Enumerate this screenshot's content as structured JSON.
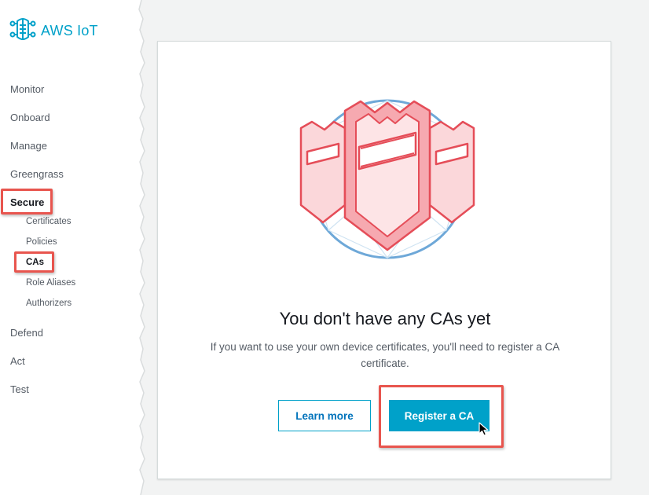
{
  "app": {
    "brand_name": "AWS IoT",
    "brand_color": "#00a1c9"
  },
  "sidebar": {
    "items": [
      {
        "label": "Monitor"
      },
      {
        "label": "Onboard"
      },
      {
        "label": "Manage"
      },
      {
        "label": "Greengrass"
      },
      {
        "label": "Secure",
        "active": true
      },
      {
        "label": "Defend"
      },
      {
        "label": "Act"
      },
      {
        "label": "Test"
      }
    ],
    "secure_subitems": [
      {
        "label": "Certificates"
      },
      {
        "label": "Policies"
      },
      {
        "label": "CAs",
        "active": true
      },
      {
        "label": "Role Aliases"
      },
      {
        "label": "Authorizers"
      }
    ]
  },
  "main": {
    "empty_state": {
      "illustration": "ca-shields-illustration",
      "title": "You don't have any CAs yet",
      "description": "If you want to use your own device certificates, you'll need to register a CA certificate.",
      "secondary_button": "Learn more",
      "primary_button": "Register a CA"
    }
  },
  "colors": {
    "accent": "#00a1c9",
    "link": "#0073bb",
    "highlight": "#e8554e"
  }
}
